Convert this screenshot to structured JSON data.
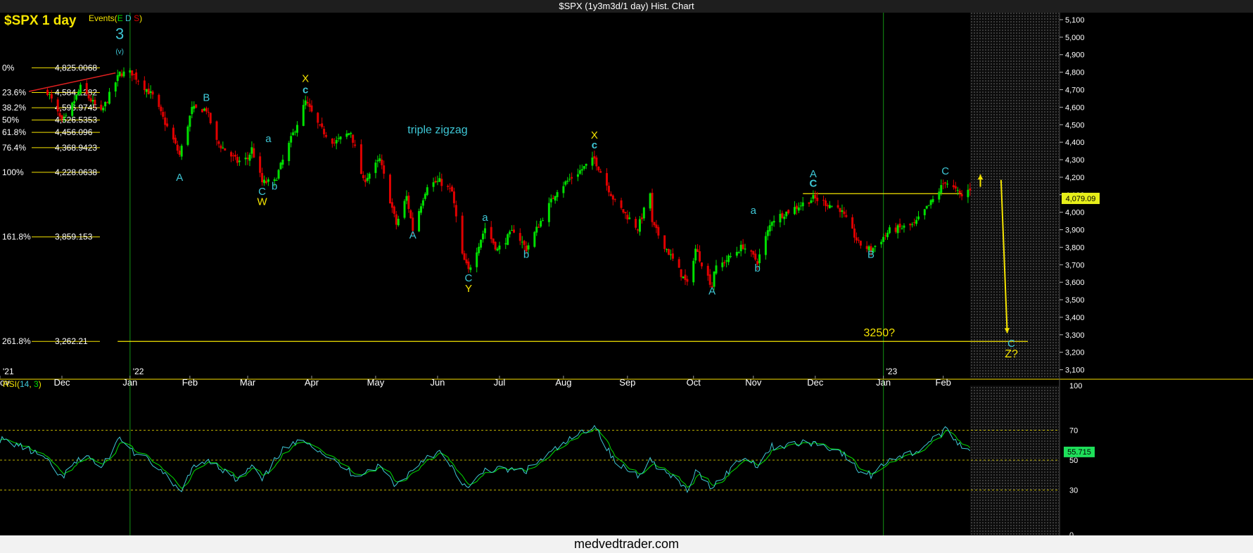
{
  "window": {
    "title": "$SPX (1y3m3d/1 day) Hist. Chart"
  },
  "chart_header": {
    "symbol_title": "$SPX 1 day",
    "events_label": "Events(",
    "events_e": "E",
    "events_d": "D",
    "events_s": "S",
    "events_close": ")"
  },
  "footer": {
    "brand": "medvedtrader.com"
  },
  "colors": {
    "up": "#00e000",
    "down": "#e00000",
    "wave_cyan": "#3ec7d6",
    "wave_yellow": "#f5e400",
    "grid_green": "#0f7a0f",
    "axis_line": "#c8b400"
  },
  "chart_data": {
    "type": "candlestick",
    "price_axis": {
      "ylim": [
        3050,
        5120
      ],
      "ticks": [
        "5,100",
        "5,000",
        "4,900",
        "4,800",
        "4,700",
        "4,600",
        "4,500",
        "4,400",
        "4,300",
        "4,200",
        "4,100",
        "4,000",
        "3,900",
        "3,800",
        "3,700",
        "3,600",
        "3,500",
        "3,400",
        "3,300",
        "3,200",
        "3,100"
      ],
      "tick_values": [
        5100,
        5000,
        4900,
        4800,
        4700,
        4600,
        4500,
        4400,
        4300,
        4200,
        4100,
        4000,
        3900,
        3800,
        3700,
        3600,
        3500,
        3400,
        3300,
        3200,
        3100
      ]
    },
    "months": [
      {
        "label": "ov",
        "date": "2021-11-01"
      },
      {
        "label": "Dec",
        "date": "2021-12-01"
      },
      {
        "label": "Jan",
        "date": "2022-01-03"
      },
      {
        "label": "Feb",
        "date": "2022-02-01"
      },
      {
        "label": "Mar",
        "date": "2022-03-01"
      },
      {
        "label": "Apr",
        "date": "2022-04-01"
      },
      {
        "label": "May",
        "date": "2022-05-02"
      },
      {
        "label": "Jun",
        "date": "2022-06-01"
      },
      {
        "label": "Jul",
        "date": "2022-07-01"
      },
      {
        "label": "Aug",
        "date": "2022-08-01"
      },
      {
        "label": "Sep",
        "date": "2022-09-01"
      },
      {
        "label": "Oct",
        "date": "2022-10-03"
      },
      {
        "label": "Nov",
        "date": "2022-11-01"
      },
      {
        "label": "Dec",
        "date": "2022-12-01"
      },
      {
        "label": "Jan",
        "date": "2023-01-03"
      },
      {
        "label": "Feb",
        "date": "2023-02-01"
      }
    ],
    "year_labels": [
      {
        "label": "'21",
        "date": "2021-11-01"
      },
      {
        "label": "'22",
        "date": "2022-01-03"
      },
      {
        "label": "'23",
        "date": "2023-01-03"
      }
    ],
    "date_range": [
      "2021-11-01",
      "2023-02-14"
    ],
    "future_zone_start": "2023-02-14",
    "future_zone_end": "2023-03-29",
    "year_divider_dates": [
      "2022-01-03",
      "2023-01-03"
    ],
    "price_path": [
      [
        "2021-11-24",
        4690
      ],
      [
        "2021-12-01",
        4513
      ],
      [
        "2021-12-03",
        4538
      ],
      [
        "2021-12-10",
        4712
      ],
      [
        "2021-12-20",
        4568
      ],
      [
        "2021-12-29",
        4793
      ],
      [
        "2022-01-04",
        4796
      ],
      [
        "2022-01-14",
        4662
      ],
      [
        "2022-01-24",
        4410
      ],
      [
        "2022-01-27",
        4326
      ],
      [
        "2022-02-02",
        4589
      ],
      [
        "2022-02-09",
        4587
      ],
      [
        "2022-02-14",
        4401
      ],
      [
        "2022-02-24",
        4288
      ],
      [
        "2022-03-01",
        4306
      ],
      [
        "2022-03-03",
        4363
      ],
      [
        "2022-03-08",
        4170
      ],
      [
        "2022-03-14",
        4173
      ],
      [
        "2022-03-29",
        4631
      ],
      [
        "2022-04-05",
        4481
      ],
      [
        "2022-04-12",
        4397
      ],
      [
        "2022-04-20",
        4459
      ],
      [
        "2022-04-26",
        4175
      ],
      [
        "2022-05-04",
        4300
      ],
      [
        "2022-05-12",
        3930
      ],
      [
        "2022-05-17",
        4088
      ],
      [
        "2022-05-20",
        3901
      ],
      [
        "2022-05-27",
        4158
      ],
      [
        "2022-06-02",
        4176
      ],
      [
        "2022-06-08",
        4115
      ],
      [
        "2022-06-13",
        3750
      ],
      [
        "2022-06-16",
        3666
      ],
      [
        "2022-06-24",
        3911
      ],
      [
        "2022-06-30",
        3785
      ],
      [
        "2022-07-08",
        3899
      ],
      [
        "2022-07-14",
        3790
      ],
      [
        "2022-07-29",
        4130
      ],
      [
        "2022-08-16",
        4305
      ],
      [
        "2022-08-26",
        4057
      ],
      [
        "2022-09-06",
        3908
      ],
      [
        "2022-09-12",
        4110
      ],
      [
        "2022-09-13",
        3932
      ],
      [
        "2022-09-30",
        3585
      ],
      [
        "2022-10-04",
        3791
      ],
      [
        "2022-10-12",
        3577
      ],
      [
        "2022-10-13",
        3669
      ],
      [
        "2022-10-27",
        3807
      ],
      [
        "2022-11-03",
        3719
      ],
      [
        "2022-11-10",
        3956
      ],
      [
        "2022-11-30",
        4080
      ],
      [
        "2022-12-13",
        4019
      ],
      [
        "2022-12-22",
        3822
      ],
      [
        "2022-12-28",
        3783
      ],
      [
        "2023-01-06",
        3895
      ],
      [
        "2023-01-18",
        3928
      ],
      [
        "2023-01-27",
        4070
      ],
      [
        "2023-02-02",
        4179
      ],
      [
        "2023-02-10",
        4090
      ],
      [
        "2023-02-14",
        4136
      ]
    ],
    "last_price_label": "4,079.09",
    "last_price_value": 4079.09,
    "fibonacci_levels": [
      {
        "pct": "0%",
        "value_label": "4,825.0068",
        "value": 4825.0068
      },
      {
        "pct": "23.6%",
        "value_label": "4,584.1282",
        "value": 4684.1282
      },
      {
        "pct": "38.2%",
        "value_label": "4,596.9745",
        "value": 4596.9745
      },
      {
        "pct": "50%",
        "value_label": "4,526.5353",
        "value": 4526.5353
      },
      {
        "pct": "61.8%",
        "value_label": "4,456.096",
        "value": 4456.096
      },
      {
        "pct": "76.4%",
        "value_label": "4,368.9423",
        "value": 4368.9423
      },
      {
        "pct": "100%",
        "value_label": "4,228.0638",
        "value": 4228.0638
      },
      {
        "pct": "161.8%",
        "value_label": "3,859.153",
        "value": 3859.153
      },
      {
        "pct": "261.8%",
        "value_label": "3,262.21",
        "value": 3262.21
      }
    ],
    "wave_labels": [
      {
        "text": "3",
        "date": "2021-12-29",
        "price": 4990,
        "color": "cyan",
        "size": "big"
      },
      {
        "text": "(v)",
        "date": "2021-12-29",
        "price": 4905,
        "color": "cyan",
        "size": "tiny"
      },
      {
        "text": "A",
        "date": "2022-01-27",
        "price": 4180,
        "color": "cyan"
      },
      {
        "text": "B",
        "date": "2022-02-09",
        "price": 4635,
        "color": "cyan"
      },
      {
        "text": "C",
        "date": "2022-03-08",
        "price": 4100,
        "color": "cyan"
      },
      {
        "text": "W",
        "date": "2022-03-08",
        "price": 4040,
        "color": "yellow"
      },
      {
        "text": "a",
        "date": "2022-03-11",
        "price": 4400,
        "color": "cyan"
      },
      {
        "text": "b",
        "date": "2022-03-14",
        "price": 4130,
        "color": "cyan"
      },
      {
        "text": "X",
        "date": "2022-03-29",
        "price": 4745,
        "color": "yellow"
      },
      {
        "text": "c",
        "date": "2022-03-29",
        "price": 4680,
        "color": "cyan",
        "bold": true
      },
      {
        "text": "A",
        "date": "2022-05-20",
        "price": 3850,
        "color": "cyan"
      },
      {
        "text": "triple zigzag",
        "date": "2022-06-01",
        "price": 4450,
        "color": "cyan",
        "size": "mid"
      },
      {
        "text": "a",
        "date": "2022-06-24",
        "price": 3950,
        "color": "cyan"
      },
      {
        "text": "C",
        "date": "2022-06-16",
        "price": 3605,
        "color": "cyan"
      },
      {
        "text": "Y",
        "date": "2022-06-16",
        "price": 3545,
        "color": "yellow"
      },
      {
        "text": "b",
        "date": "2022-07-14",
        "price": 3740,
        "color": "cyan"
      },
      {
        "text": "X",
        "date": "2022-08-16",
        "price": 4420,
        "color": "yellow"
      },
      {
        "text": "c",
        "date": "2022-08-16",
        "price": 4365,
        "color": "cyan",
        "bold": true
      },
      {
        "text": "A",
        "date": "2022-10-12",
        "price": 3530,
        "color": "cyan"
      },
      {
        "text": "a",
        "date": "2022-11-01",
        "price": 3990,
        "color": "cyan"
      },
      {
        "text": "b",
        "date": "2022-11-03",
        "price": 3660,
        "color": "cyan"
      },
      {
        "text": "A",
        "date": "2022-11-30",
        "price": 4200,
        "color": "cyan"
      },
      {
        "text": "C",
        "date": "2022-11-30",
        "price": 4145,
        "color": "cyan",
        "bold": true
      },
      {
        "text": "B",
        "date": "2022-12-28",
        "price": 3740,
        "color": "cyan"
      },
      {
        "text": "C",
        "date": "2023-02-02",
        "price": 4215,
        "color": "cyan"
      },
      {
        "text": "3250?",
        "date": "2023-01-01",
        "price": 3292,
        "color": "yellow",
        "size": "mid"
      },
      {
        "text": "C",
        "date": "2023-03-06",
        "price": 3230,
        "color": "cyan"
      },
      {
        "text": "Z?",
        "date": "2023-03-06",
        "price": 3170,
        "color": "yellow",
        "size": "mid"
      }
    ],
    "horizontal_lines": [
      {
        "from": "2021-12-28",
        "to": "2023-03-14",
        "price": 3262,
        "color": "yellow"
      },
      {
        "from": "2022-11-25",
        "to": "2023-02-10",
        "price": 4106,
        "color": "yellow"
      }
    ],
    "trend_line": {
      "from": [
        "2021-11-15",
        4690
      ],
      "to": [
        "2021-12-27",
        4796
      ],
      "color": "red"
    },
    "projection_arrows": [
      {
        "from": [
          "2023-02-19",
          4145
        ],
        "to": [
          "2023-02-19",
          4215
        ],
        "color": "yellow"
      },
      {
        "from": [
          "2023-03-01",
          4185
        ],
        "to": [
          "2023-03-04",
          3310
        ],
        "color": "yellow"
      }
    ],
    "rsi": {
      "label": "RSI(",
      "period_label": "14",
      "sep": ",",
      "smooth_label": "3",
      "close": ")",
      "ylim": [
        0,
        100
      ],
      "ticks": [
        "100",
        "70",
        "50",
        "30",
        "0"
      ],
      "tick_values": [
        100,
        70,
        50,
        30,
        0
      ],
      "last_label": "55.715",
      "last_value": 55.715,
      "path": [
        [
          "2021-11-01",
          64
        ],
        [
          "2021-11-10",
          60
        ],
        [
          "2021-11-22",
          52
        ],
        [
          "2021-12-01",
          38
        ],
        [
          "2021-12-06",
          46
        ],
        [
          "2021-12-13",
          54
        ],
        [
          "2021-12-20",
          44
        ],
        [
          "2021-12-29",
          65
        ],
        [
          "2022-01-05",
          55
        ],
        [
          "2022-01-14",
          48
        ],
        [
          "2022-01-27",
          29
        ],
        [
          "2022-02-03",
          45
        ],
        [
          "2022-02-10",
          51
        ],
        [
          "2022-02-24",
          36
        ],
        [
          "2022-03-03",
          46
        ],
        [
          "2022-03-08",
          36
        ],
        [
          "2022-03-17",
          56
        ],
        [
          "2022-03-29",
          64
        ],
        [
          "2022-04-12",
          49
        ],
        [
          "2022-04-22",
          40
        ],
        [
          "2022-05-04",
          46
        ],
        [
          "2022-05-12",
          33
        ],
        [
          "2022-05-27",
          53
        ],
        [
          "2022-06-02",
          55
        ],
        [
          "2022-06-16",
          30
        ],
        [
          "2022-06-24",
          44
        ],
        [
          "2022-07-14",
          43
        ],
        [
          "2022-07-29",
          58
        ],
        [
          "2022-08-16",
          74
        ],
        [
          "2022-08-26",
          48
        ],
        [
          "2022-09-06",
          40
        ],
        [
          "2022-09-12",
          50
        ],
        [
          "2022-09-30",
          30
        ],
        [
          "2022-10-04",
          42
        ],
        [
          "2022-10-12",
          32
        ],
        [
          "2022-10-27",
          52
        ],
        [
          "2022-11-03",
          47
        ],
        [
          "2022-11-10",
          59
        ],
        [
          "2022-11-30",
          62
        ],
        [
          "2022-12-13",
          56
        ],
        [
          "2022-12-22",
          43
        ],
        [
          "2022-12-28",
          40
        ],
        [
          "2023-01-06",
          51
        ],
        [
          "2023-01-18",
          55
        ],
        [
          "2023-01-27",
          64
        ],
        [
          "2023-02-02",
          70
        ],
        [
          "2023-02-10",
          60
        ],
        [
          "2023-02-14",
          56
        ]
      ]
    }
  }
}
